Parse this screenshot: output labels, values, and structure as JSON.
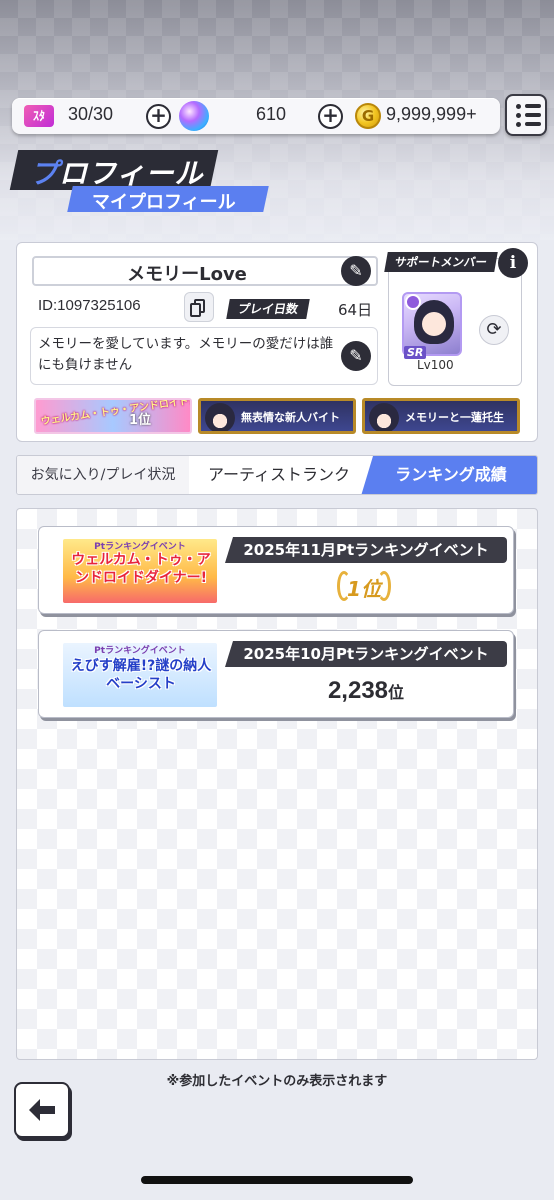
{
  "status": {
    "stamina": "30/30",
    "gems": "610",
    "coins": "9,999,999+",
    "stamina_icon_text": "ｽﾀ"
  },
  "header": {
    "title_accent": "プ",
    "title_rest": "ロフィール",
    "subtitle": "マイプロフィール"
  },
  "profile": {
    "name": "メモリーLove",
    "id": "ID:1097325106",
    "play_days_label": "プレイ日数",
    "play_days_value": "64日",
    "comment": "メモリーを愛しています。メモリーの愛だけは誰にも負けません",
    "support_label": "サポートメンバー",
    "support_rarity": "SR",
    "support_level": "Lv100",
    "titles": [
      {
        "text": "ウェルカム・トゥ・アンドロイドダイナー!",
        "rank": "1位"
      },
      {
        "text": "無表情な新人バイト"
      },
      {
        "text": "メモリーと一蓮托生"
      }
    ]
  },
  "tabs": [
    {
      "label": "お気に入り/プレイ状況"
    },
    {
      "label": "アーティストランク"
    },
    {
      "label": "ランキング成績"
    }
  ],
  "events": [
    {
      "kicker": "Ptランキングイベント",
      "logo": "ウェルカム・トゥ・アンドロイドダイナー!",
      "name": "2025年11月Ptランキングイベント",
      "rank": "1位"
    },
    {
      "kicker": "Ptランキングイベント",
      "logo": "えびす解雇!?謎の納人ベーシスト",
      "name": "2025年10月Ptランキングイベント",
      "rank_number": "2,238",
      "rank_unit": "位"
    }
  ],
  "note": "※参加したイベントのみ表示されます",
  "colors": {
    "accent": "#5b7ff0",
    "dark": "#2d2d37"
  }
}
